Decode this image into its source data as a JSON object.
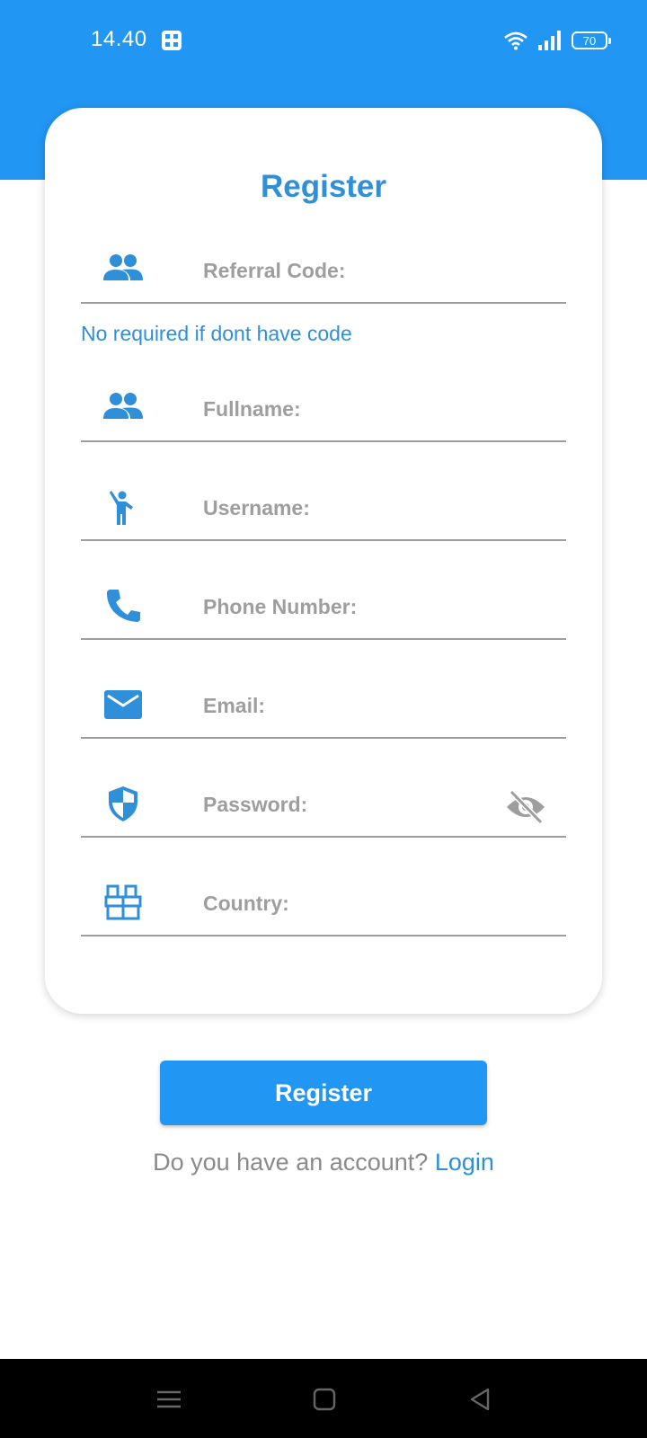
{
  "status": {
    "time": "14.40",
    "battery": "70",
    "icons": [
      "app-notification-icon",
      "wifi-icon",
      "signal-icon",
      "battery-icon"
    ]
  },
  "colors": {
    "primary": "#2196f3",
    "accent_text": "#2f8fd8",
    "muted_text": "#9e9e9e"
  },
  "form": {
    "title": "Register",
    "referral_hint": "No required if dont have code",
    "fields": [
      {
        "label": "Referral Code:",
        "icon": "group-icon"
      },
      {
        "label": "Fullname:",
        "icon": "group-icon"
      },
      {
        "label": "Username:",
        "icon": "person-waving-icon"
      },
      {
        "label": "Phone Number:",
        "icon": "phone-icon"
      },
      {
        "label": "Email:",
        "icon": "mail-icon"
      },
      {
        "label": "Password:",
        "icon": "shield-icon",
        "trailing_icon": "visibility-off-icon"
      },
      {
        "label": "Country:",
        "icon": "country-icon"
      }
    ]
  },
  "actions": {
    "register_label": "Register",
    "account_prompt": "Do you have an account?",
    "login_label": "Login"
  },
  "nav": {
    "icons": [
      "menu-icon",
      "home-square-icon",
      "back-triangle-icon"
    ]
  }
}
